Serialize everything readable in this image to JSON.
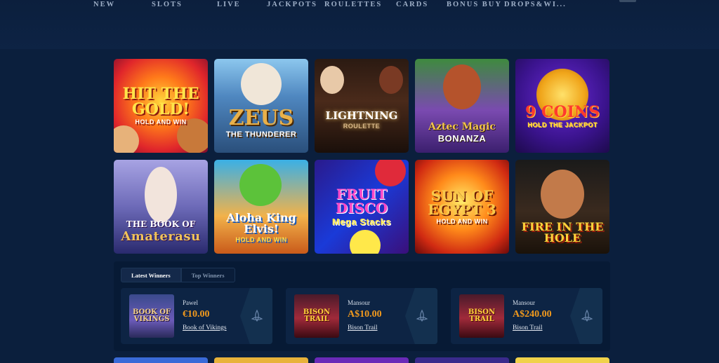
{
  "nav": {
    "items": [
      "NEW",
      "SLOTS",
      "LIVE",
      "JACKPOTS",
      "ROULETTES",
      "CARDS",
      "BONUS BUY",
      "DROPS&WI..."
    ]
  },
  "games": [
    {
      "title": "HIT THE GOLD!",
      "subtitle": "HOLD AND WIN"
    },
    {
      "title": "ZEUS",
      "subtitle": "THE THUNDERER"
    },
    {
      "title": "LIGHTNING",
      "subtitle": "ROULETTE"
    },
    {
      "title": "Aztec Magic",
      "subtitle": "BONANZA"
    },
    {
      "title": "9 COINS",
      "subtitle": "HOLD THE JACKPOT"
    },
    {
      "title": "THE BOOK OF",
      "subtitle": "Amaterasu"
    },
    {
      "title": "Aloha King Elvis!",
      "subtitle": "HOLD AND WIN"
    },
    {
      "title": "FRUIT DISCO",
      "subtitle": "Mega Stacks"
    },
    {
      "title": "SUN OF EGYPT 3",
      "subtitle": "HOLD AND WIN"
    },
    {
      "title": "FIRE IN THE HOLE",
      "subtitle": ""
    }
  ],
  "winners": {
    "tabs": [
      "Latest Winners",
      "Top Winners"
    ],
    "cards": [
      {
        "player": "Pawel",
        "amount": "€10.00",
        "game": "Book of Vikings",
        "thumb_text": "BOOK OF VIKINGS"
      },
      {
        "player": "Mansour",
        "amount": "A$10.00",
        "game": "Bison Trail",
        "thumb_text": "BISON TRAIL"
      },
      {
        "player": "Mansour",
        "amount": "A$240.00",
        "game": "Bison Trail",
        "thumb_text": "BISON TRAIL"
      }
    ]
  },
  "colors": {
    "background": "#0b1f3d",
    "panel": "#071a35",
    "card": "#0d2444",
    "amount": "#f29a1d"
  }
}
